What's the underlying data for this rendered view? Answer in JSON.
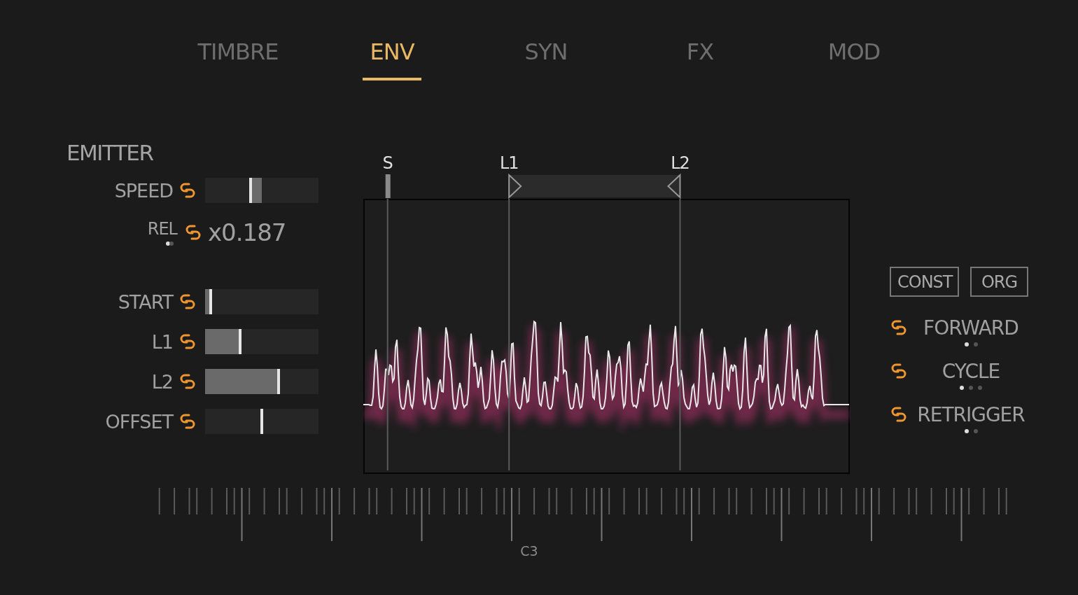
{
  "tabs": [
    {
      "label": "TIMBRE",
      "selected": false
    },
    {
      "label": "ENV",
      "selected": true
    },
    {
      "label": "SYN",
      "selected": false
    },
    {
      "label": "FX",
      "selected": false
    },
    {
      "label": "MOD",
      "selected": false
    }
  ],
  "emitter": {
    "title": "EMITTER",
    "controls": [
      {
        "kind": "bipolar",
        "label": "SPEED",
        "level": 0.4
      },
      {
        "kind": "value",
        "label": "REL",
        "value": "x0.187",
        "dots": [
          {
            "selected": true
          },
          {
            "selected": false
          }
        ]
      },
      {
        "kind": "unipolar",
        "label": "START",
        "level": 0.05
      },
      {
        "kind": "unipolar",
        "label": "L1",
        "level": 0.31
      },
      {
        "kind": "unipolar",
        "label": "L2",
        "level": 0.65
      },
      {
        "kind": "bipolar",
        "label": "OFFSET",
        "level": 0.5
      }
    ]
  },
  "display": {
    "markers": [
      {
        "kind": "start",
        "label": "S",
        "level": 0.05
      },
      {
        "kind": "loop-start",
        "label": "L1",
        "level": 0.3
      },
      {
        "kind": "loop-end",
        "label": "L2",
        "level": 0.652
      }
    ]
  },
  "buttons": [
    "CONST",
    "ORG"
  ],
  "modes": [
    {
      "label": "FORWARD",
      "dots": [
        {
          "selected": true
        },
        {
          "selected": false
        }
      ]
    },
    {
      "label": "CYCLE",
      "dots": [
        {
          "selected": true
        },
        {
          "selected": false
        },
        {
          "selected": false
        }
      ]
    },
    {
      "label": "RETRIGGER",
      "dots": [
        {
          "selected": true
        },
        {
          "selected": false
        }
      ]
    }
  ],
  "keyboard": {
    "label": "C3"
  }
}
